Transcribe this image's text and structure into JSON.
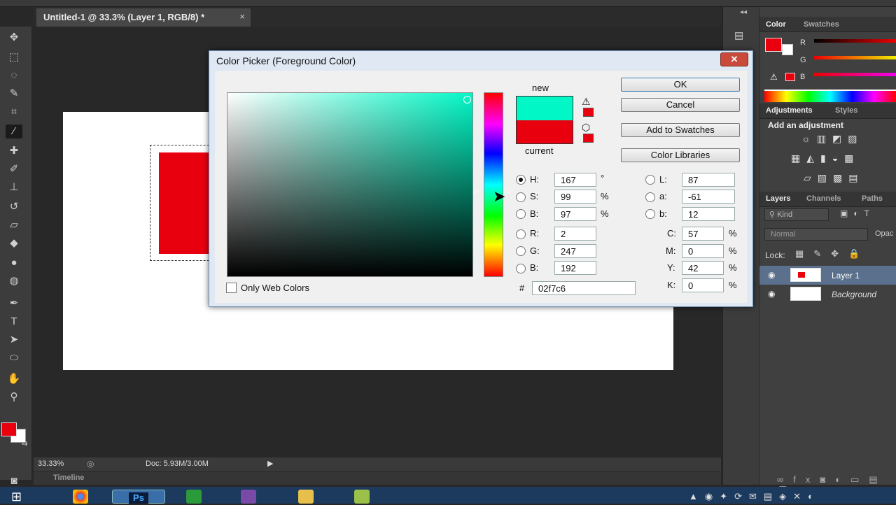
{
  "document": {
    "tab_title": "Untitled-1 @ 33.3% (Layer 1, RGB/8) *",
    "tab_close": "×",
    "zoom": "33.33%",
    "doc_info": "Doc: 5.93M/3.00M",
    "timeline_label": "Timeline"
  },
  "colors": {
    "foreground": "#e8000f",
    "background": "#ffffff",
    "new_color": "#02f7c6",
    "current_color": "#e8000f"
  },
  "right_panels": {
    "color_tabs": [
      "Color",
      "Swatches"
    ],
    "rgb_labels": [
      "R",
      "G",
      "B"
    ],
    "adjustments_tabs": [
      "Adjustments",
      "Styles"
    ],
    "adjustments_hint": "Add an adjustment",
    "layers_tabs": [
      "Layers",
      "Channels",
      "Paths"
    ],
    "kind_filter": "Kind",
    "blend_mode": "Normal",
    "opacity_label": "Opac",
    "lock_label": "Lock:",
    "layers": [
      {
        "name": "Layer 1",
        "italic": false
      },
      {
        "name": "Background",
        "italic": true
      }
    ]
  },
  "dialog": {
    "title": "Color Picker (Foreground Color)",
    "close": "✕",
    "new_label": "new",
    "current_label": "current",
    "buttons": {
      "ok": "OK",
      "cancel": "Cancel",
      "add_to_swatches": "Add to Swatches",
      "color_libraries": "Color Libraries"
    },
    "hsb": [
      {
        "label": "H:",
        "value": "167",
        "unit": "°",
        "selected": true
      },
      {
        "label": "S:",
        "value": "99",
        "unit": "%",
        "selected": false
      },
      {
        "label": "B:",
        "value": "97",
        "unit": "%",
        "selected": false
      }
    ],
    "rgb": [
      {
        "label": "R:",
        "value": "2"
      },
      {
        "label": "G:",
        "value": "247"
      },
      {
        "label": "B:",
        "value": "192"
      }
    ],
    "lab": [
      {
        "label": "L:",
        "value": "87"
      },
      {
        "label": "a:",
        "value": "-61"
      },
      {
        "label": "b:",
        "value": "12"
      }
    ],
    "cmyk": [
      {
        "label": "C:",
        "value": "57",
        "unit": "%"
      },
      {
        "label": "M:",
        "value": "0",
        "unit": "%"
      },
      {
        "label": "Y:",
        "value": "42",
        "unit": "%"
      },
      {
        "label": "K:",
        "value": "0",
        "unit": "%"
      }
    ],
    "hex_label": "#",
    "hex_value": "02f7c6",
    "only_web_colors": "Only Web Colors"
  },
  "icons": {
    "gamut_warning": "warning-triangle-icon",
    "web_safe": "cube-icon",
    "cursor": "mouse-pointer-icon"
  }
}
